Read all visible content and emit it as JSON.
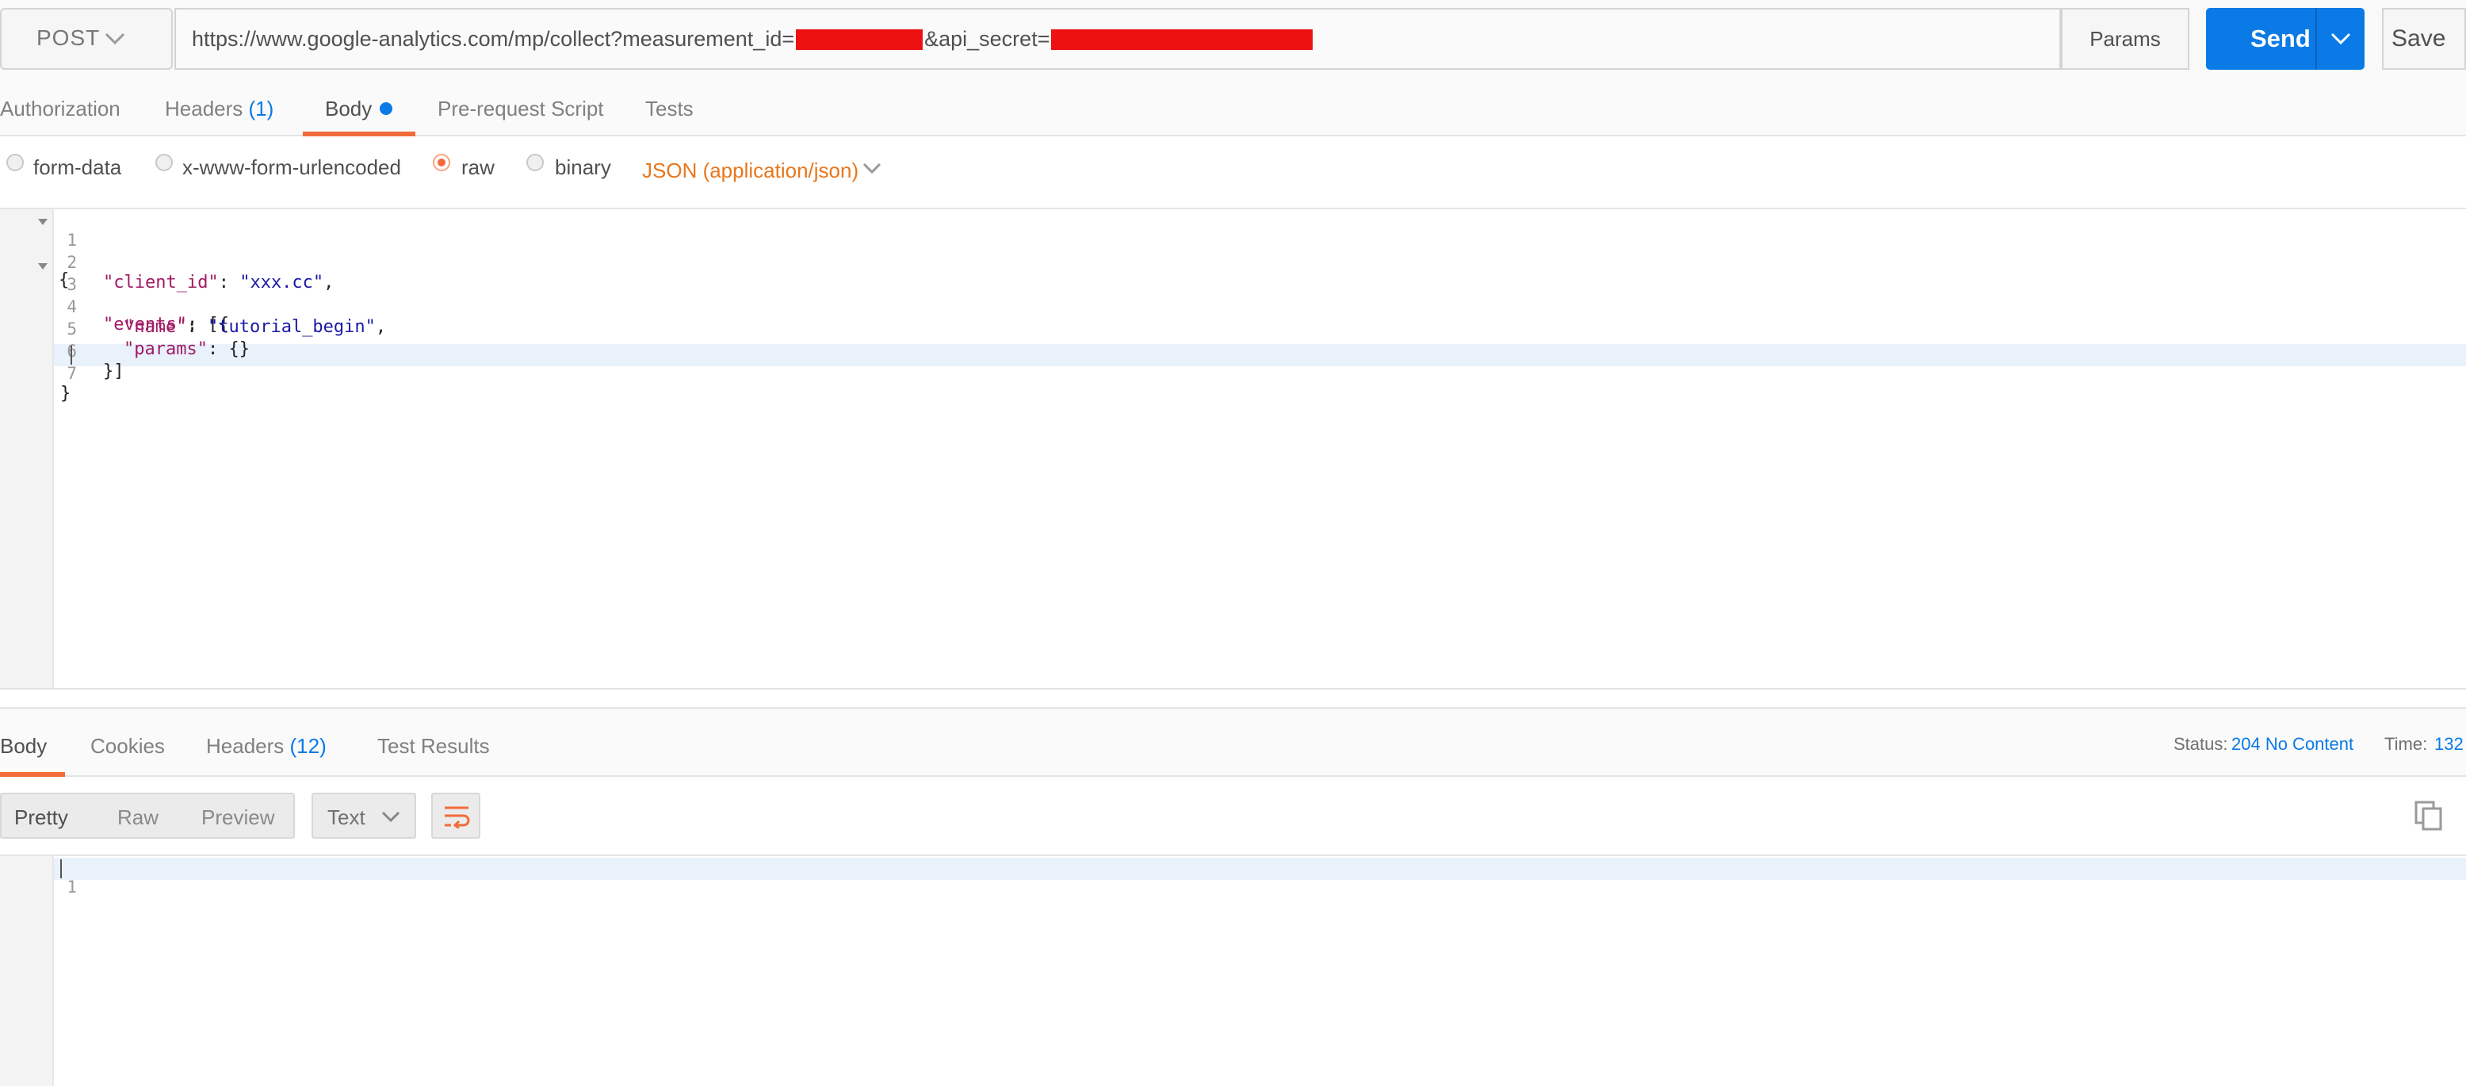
{
  "request": {
    "method": "POST",
    "url_prefix": "https://www.google-analytics.com/mp/collect?measurement_id=",
    "url_middle": "&api_secret=",
    "params_label": "Params",
    "send_label": "Send",
    "save_label": "Save"
  },
  "request_tabs": {
    "authorization": "Authorization",
    "headers": "Headers",
    "headers_count": "(1)",
    "body": "Body",
    "prerequest": "Pre-request Script",
    "tests": "Tests"
  },
  "body_types": {
    "form_data": "form-data",
    "urlencoded": "x-www-form-urlencoded",
    "raw": "raw",
    "binary": "binary",
    "selected_format": "JSON (application/json)"
  },
  "request_body": {
    "line_numbers": [
      "1",
      "2",
      "3",
      "4",
      "5",
      "6",
      "7"
    ],
    "l1": "{",
    "l2_key": "\"client_id\"",
    "l2_sep": ": ",
    "l2_val": "\"xxx.cc\"",
    "l2_end": ",",
    "l3_key": "\"events\"",
    "l3_end": ": [{",
    "l4_key": "\"name\"",
    "l4_sep": ": ",
    "l4_val": "\"tutorial_begin\"",
    "l4_end": ",",
    "l5_key": "\"params\"",
    "l5_end": ": {}",
    "l6": "}]",
    "l7": "}"
  },
  "response_tabs": {
    "body": "Body",
    "cookies": "Cookies",
    "headers": "Headers",
    "headers_count": "(12)",
    "test_results": "Test Results",
    "status_label": "Status:",
    "status_value": "204 No Content",
    "time_label": "Time:",
    "time_value": "132"
  },
  "response_view": {
    "pretty": "Pretty",
    "raw": "Raw",
    "preview": "Preview",
    "format": "Text",
    "line_numbers": [
      "1"
    ]
  },
  "colors": {
    "accent_orange": "#f26b3a",
    "send_blue": "#0a7ae6",
    "redaction_red": "#ee1111"
  }
}
